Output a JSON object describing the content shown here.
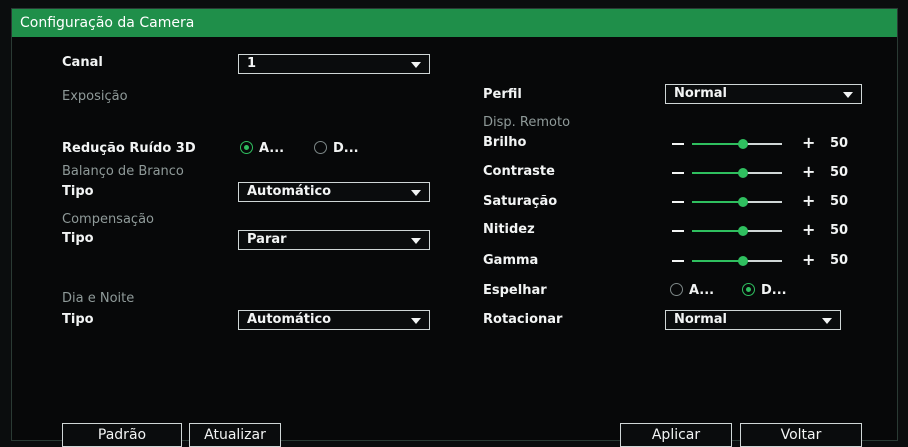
{
  "window": {
    "title": "Configuração da Camera"
  },
  "left": {
    "canal_label": "Canal",
    "canal_value": "1",
    "exposicao_section": "Exposição",
    "reducao_label": "Redução Ruído 3D",
    "reducao_option_a": "A...",
    "reducao_option_d": "D...",
    "reducao_selected": "A...",
    "balanco_section": "Balanço de Branco",
    "balanco_tipo_label": "Tipo",
    "balanco_tipo_value": "Automático",
    "compensacao_section": "Compensação",
    "compensacao_tipo_label": "Tipo",
    "compensacao_tipo_value": "Parar",
    "dia_noite_section": "Dia e Noite",
    "dia_noite_tipo_label": "Tipo",
    "dia_noite_tipo_value": "Automático"
  },
  "right": {
    "perfil_label": "Perfil",
    "perfil_value": "Normal",
    "disp_remoto_section": "Disp. Remoto",
    "sliders": [
      {
        "label": "Brilho",
        "value": "50"
      },
      {
        "label": "Contraste",
        "value": "50"
      },
      {
        "label": "Saturação",
        "value": "50"
      },
      {
        "label": "Nitidez",
        "value": "50"
      },
      {
        "label": "Gamma",
        "value": "50"
      }
    ],
    "espelhar_label": "Espelhar",
    "espelhar_option_a": "A...",
    "espelhar_option_d": "D...",
    "espelhar_selected": "D...",
    "rotacionar_label": "Rotacionar",
    "rotacionar_value": "Normal"
  },
  "buttons": {
    "padrao": "Padrão",
    "atualizar": "Atualizar",
    "aplicar": "Aplicar",
    "voltar": "Voltar"
  },
  "colors": {
    "accent": "#1f8f4a",
    "active": "#2fbf5f",
    "background": "#070809"
  }
}
